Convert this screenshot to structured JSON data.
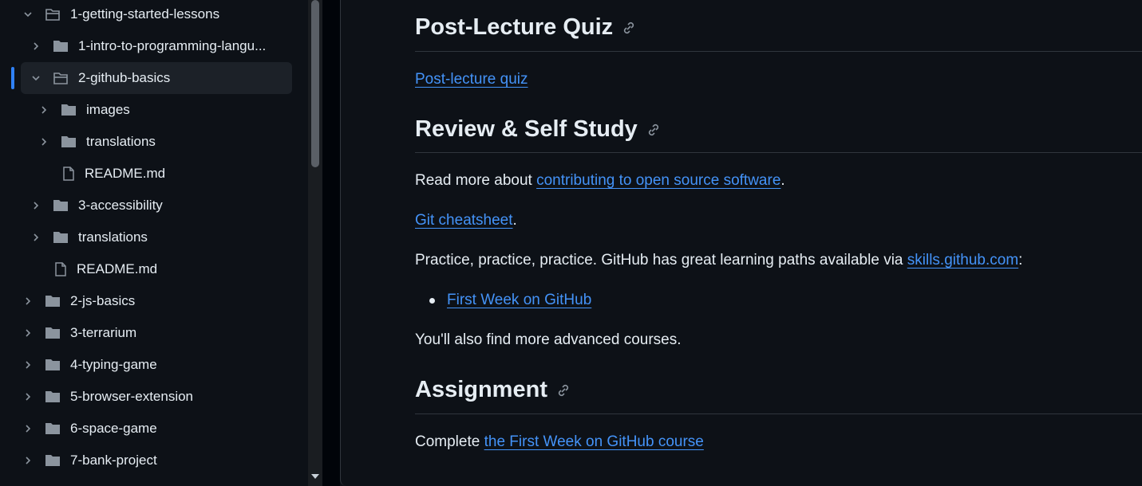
{
  "sidebar": {
    "items": [
      {
        "label": "1-getting-started-lessons",
        "type": "folder",
        "expanded": true
      },
      {
        "label": "1-intro-to-programming-langu...",
        "type": "folder",
        "expanded": false
      },
      {
        "label": "2-github-basics",
        "type": "folder",
        "expanded": true,
        "selected": true
      },
      {
        "label": "images",
        "type": "folder",
        "expanded": false
      },
      {
        "label": "translations",
        "type": "folder",
        "expanded": false
      },
      {
        "label": "README.md",
        "type": "file"
      },
      {
        "label": "3-accessibility",
        "type": "folder",
        "expanded": false
      },
      {
        "label": "translations",
        "type": "folder",
        "expanded": false
      },
      {
        "label": "README.md",
        "type": "file"
      },
      {
        "label": "2-js-basics",
        "type": "folder",
        "expanded": false
      },
      {
        "label": "3-terrarium",
        "type": "folder",
        "expanded": false
      },
      {
        "label": "4-typing-game",
        "type": "folder",
        "expanded": false
      },
      {
        "label": "5-browser-extension",
        "type": "folder",
        "expanded": false
      },
      {
        "label": "6-space-game",
        "type": "folder",
        "expanded": false
      },
      {
        "label": "7-bank-project",
        "type": "folder",
        "expanded": false
      }
    ]
  },
  "main": {
    "quiz_heading": "Post-Lecture Quiz",
    "quiz_link": "Post-lecture quiz",
    "review_heading": "Review & Self Study",
    "read_more_prefix": "Read more about ",
    "read_more_link": "contributing to open source software",
    "read_more_suffix": ".",
    "cheatsheet_link": "Git cheatsheet",
    "cheatsheet_suffix": ".",
    "practice_prefix": "Practice, practice, practice. GitHub has great learning paths available via ",
    "practice_link": "skills.github.com",
    "practice_suffix": ":",
    "bullet_link": "First Week on GitHub",
    "advanced_text": "You'll also find more advanced courses.",
    "assignment_heading": "Assignment",
    "complete_prefix": "Complete ",
    "complete_link": "the First Week on GitHub course"
  },
  "colors": {
    "background": "#0d1117",
    "link": "#4493f8",
    "selection_accent": "#2f81f7"
  }
}
